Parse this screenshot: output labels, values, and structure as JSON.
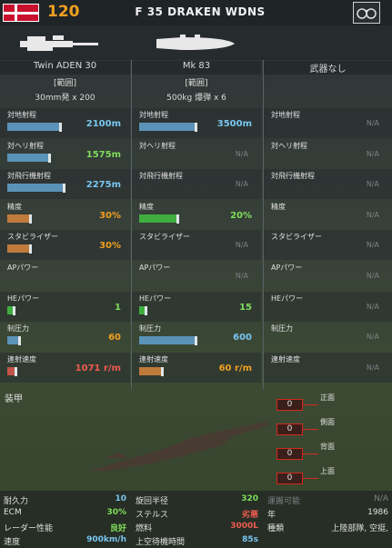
{
  "header": {
    "cost": "120",
    "title": "F 35 DRAKEN WDNS",
    "menu_icon": "binocular-icon"
  },
  "colors": {
    "gold": "#f0a020",
    "blue_bar": "#5b93b8",
    "green_bar": "#3fae3f",
    "orange_bar": "#c07b3c",
    "red_bar": "#c25448",
    "val_blue": "#78c6f0",
    "val_green": "#7fdc5a",
    "val_orange": "#f0a020",
    "val_red": "#ee5c4e"
  },
  "weapons": [
    {
      "name": "Twin ADEN 30",
      "sub1": "[範囲]",
      "sub2": "30mm発 x 200",
      "stats": {
        "ground_range": "2100m",
        "heli_range": "1575m",
        "air_range": "2275m",
        "accuracy": "30%",
        "stabilizer": "30%",
        "ap_power": "",
        "he_power": "1",
        "suppression": "60",
        "rate_of_fire": "1071 r/m"
      },
      "levels": {
        "ground_range": 0.7,
        "heli_range": 0.55,
        "air_range": 0.75,
        "accuracy": 0.3,
        "stabilizer": 0.3,
        "ap_power": 0,
        "he_power": 0.08,
        "suppression": 0.15,
        "rate_of_fire": 0.1
      }
    },
    {
      "name": "Mk 83",
      "sub1": "[範囲]",
      "sub2": "500kg 爆弾 x 6",
      "stats": {
        "ground_range": "3500m",
        "heli_range": "N/A",
        "air_range": "N/A",
        "accuracy": "20%",
        "stabilizer": "N/A",
        "ap_power": "N/A",
        "he_power": "15",
        "suppression": "600",
        "rate_of_fire": "60 r/m"
      },
      "levels": {
        "ground_range": 0.75,
        "heli_range": 0,
        "air_range": 0,
        "accuracy": 0.5,
        "stabilizer": 0,
        "ap_power": 0,
        "he_power": 0.08,
        "suppression": 0.75,
        "rate_of_fire": 0.3
      }
    },
    {
      "name": "武器なし",
      "sub1": "",
      "sub2": "",
      "stats": {
        "ground_range": "N/A",
        "heli_range": "N/A",
        "air_range": "N/A",
        "accuracy": "N/A",
        "stabilizer": "N/A",
        "ap_power": "N/A",
        "he_power": "N/A",
        "suppression": "N/A",
        "rate_of_fire": "N/A"
      },
      "levels": {
        "ground_range": 0,
        "heli_range": 0,
        "air_range": 0,
        "accuracy": 0,
        "stabilizer": 0,
        "ap_power": 0,
        "he_power": 0,
        "suppression": 0,
        "rate_of_fire": 0
      }
    }
  ],
  "stat_labels": {
    "ground_range": "対地射程",
    "heli_range": "対ヘリ射程",
    "air_range": "対飛行機射程",
    "accuracy": "精度",
    "stabilizer": "スタビライザー",
    "ap_power": "APパワー",
    "he_power": "HEパワー",
    "suppression": "制圧力",
    "rate_of_fire": "連射速度"
  },
  "armor": {
    "title": "装甲",
    "front": {
      "label": "正面",
      "value": "0"
    },
    "side": {
      "label": "側面",
      "value": "0"
    },
    "rear": {
      "label": "背面",
      "value": "0"
    },
    "top": {
      "label": "上面",
      "value": "0"
    }
  },
  "bottom": {
    "strength": {
      "label": "耐久力",
      "value": "10"
    },
    "turn_radius": {
      "label": "旋回半径",
      "value": "320"
    },
    "transport": {
      "label": "運搬可能",
      "value": "N/A"
    },
    "ecm": {
      "label": "ECM",
      "value": "30%"
    },
    "stealth": {
      "label": "ステルス",
      "value": "劣悪"
    },
    "year": {
      "label": "年",
      "value": "1986"
    },
    "radar": {
      "label": "レーダー性能",
      "value": "良好"
    },
    "fuel": {
      "label": "燃料",
      "value": "3000L"
    },
    "type": {
      "label": "種類",
      "value": "上陸部隊, 空挺,"
    },
    "speed": {
      "label": "速度",
      "value": "900km/h"
    },
    "loiter": {
      "label": "上空待機時間",
      "value": "85s"
    }
  }
}
